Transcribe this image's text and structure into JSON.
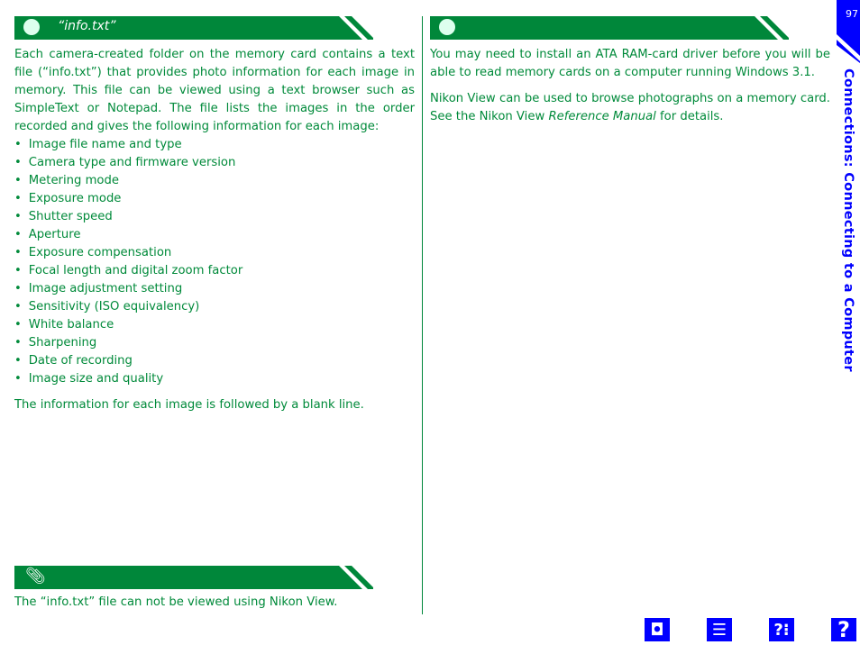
{
  "page_number": "97",
  "side_title": "Connections: Connecting to a Computer",
  "left": {
    "header_title": "“info.txt”",
    "intro": "Each camera-created folder on the memory card contains a text file (“info.txt”) that provides photo information for each image in memory. This file can be viewed using a text browser such as SimpleText or Notepad. The file lists the images in the order recorded and gives the following information for each image:",
    "items": [
      "Image file name and type",
      "Camera type and firmware version",
      "Metering mode",
      "Exposure mode",
      "Shutter speed",
      "Aperture",
      "Exposure compensation",
      "Focal length and digital zoom factor",
      "Image adjustment setting",
      "Sensitivity (ISO equivalency)",
      "White balance",
      "Sharpening",
      "Date of recording",
      "Image size and quality"
    ],
    "closing": "The information for each image is followed by a blank line.",
    "note": "The “info.txt” file can not be viewed using Nikon View."
  },
  "right": {
    "p1": "You may need to install an ATA RAM-card driver before you will be able to read memory cards on a computer running Windows 3.1.",
    "p2_a": "Nikon View can be used to browse photographs on a memory card.  See the Nikon View ",
    "p2_em": "Reference Manual",
    "p2_b": " for details."
  },
  "nav_icons": [
    "camera-icon",
    "contents-icon",
    "index-help-icon",
    "help-icon"
  ],
  "colors": {
    "green": "#00873a",
    "blue": "#0000ff"
  }
}
